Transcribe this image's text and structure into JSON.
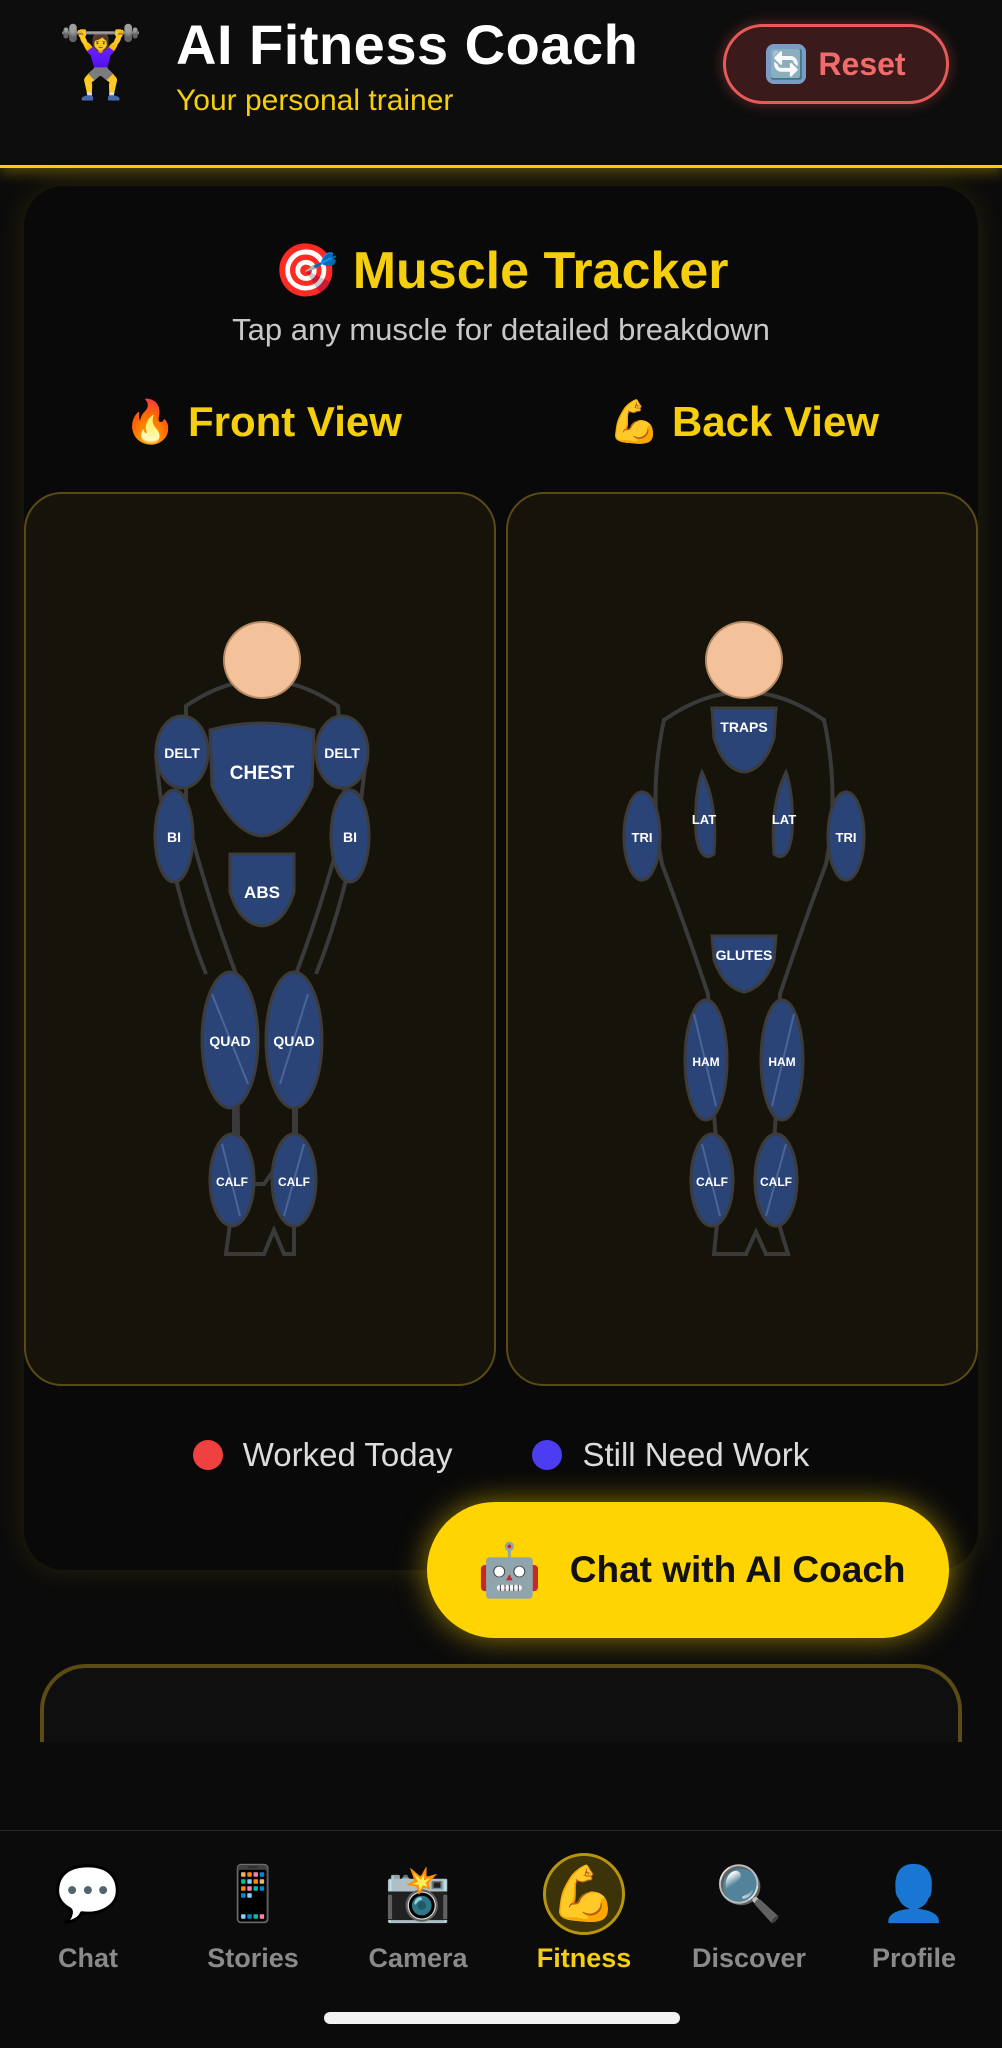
{
  "header": {
    "logo_icon": "🏋️‍♀️",
    "title": "AI Fitness Coach",
    "subtitle": "Your personal trainer",
    "reset_icon": "🔄",
    "reset_label": "Reset"
  },
  "tracker": {
    "title_icon": "🎯",
    "title": "Muscle Tracker",
    "subtitle": "Tap any muscle for detailed breakdown",
    "front_icon": "🔥",
    "front_title": "Front View",
    "back_icon": "💪",
    "back_title": "Back View",
    "front_muscles": {
      "delt_left": "DELT",
      "delt_right": "DELT",
      "chest": "CHEST",
      "bi_left": "BI",
      "bi_right": "BI",
      "abs": "ABS",
      "quad_left": "QUAD",
      "quad_right": "QUAD",
      "calf_left": "CALF",
      "calf_right": "CALF"
    },
    "back_muscles": {
      "traps": "TRAPS",
      "tri_left": "TRI",
      "tri_right": "TRI",
      "lat_left": "LAT",
      "lat_right": "LAT",
      "glutes": "GLUTES",
      "ham_left": "HAM",
      "ham_right": "HAM",
      "calf_left": "CALF",
      "calf_right": "CALF"
    },
    "legend": {
      "worked": "Worked Today",
      "need_work": "Still Need Work",
      "worked_color": "#f04040",
      "need_work_color": "#4a3ef0"
    }
  },
  "chat_cta": {
    "icon": "🤖",
    "label": "Chat with AI Coach"
  },
  "nav": {
    "items": [
      {
        "icon": "💬",
        "label": "Chat"
      },
      {
        "icon": "📱",
        "label": "Stories"
      },
      {
        "icon": "📸",
        "label": "Camera"
      },
      {
        "icon": "💪",
        "label": "Fitness"
      },
      {
        "icon": "🔍",
        "label": "Discover"
      },
      {
        "icon": "👤",
        "label": "Profile"
      }
    ]
  }
}
